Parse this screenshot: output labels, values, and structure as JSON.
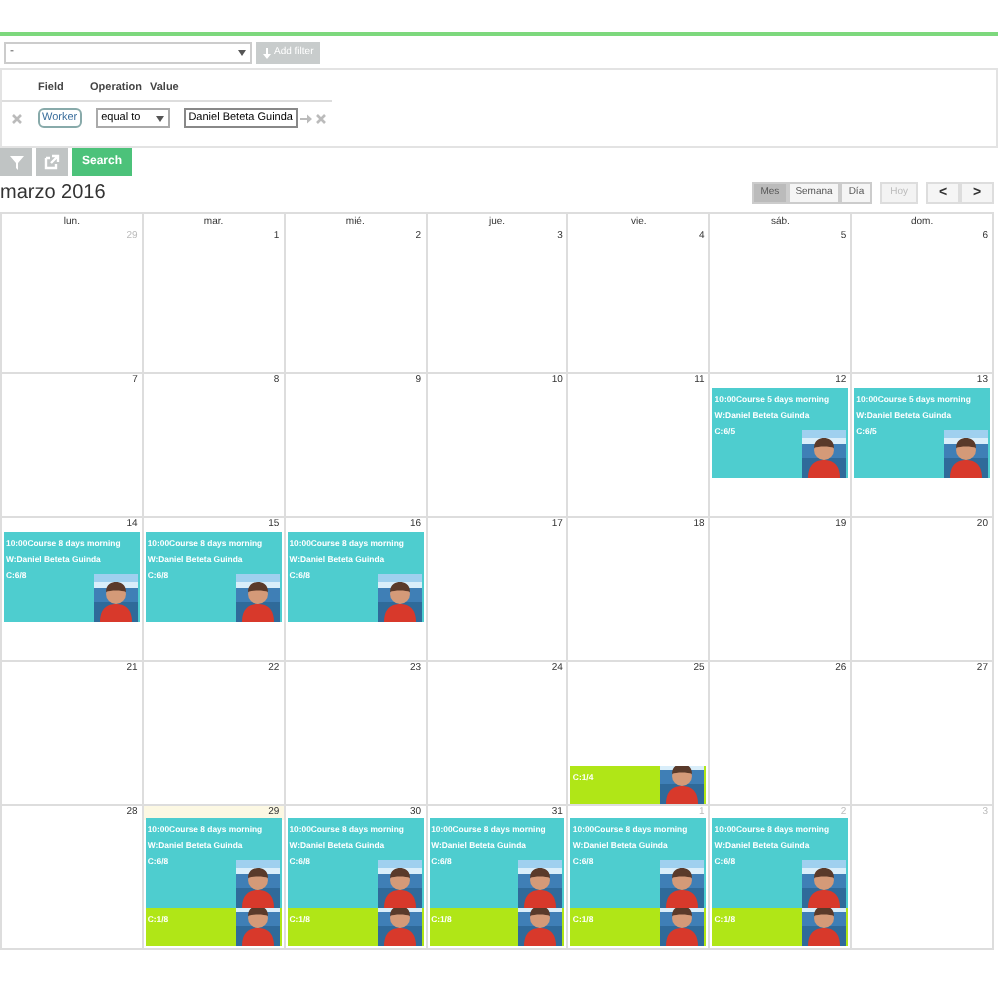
{
  "filter_bar": {
    "field_select": "-",
    "add_filter": {
      "label": "Add filter",
      "disabled": true
    }
  },
  "conditions": {
    "columns": [
      "Field",
      "Operation",
      "Value"
    ],
    "rows": [
      {
        "field": "Worker",
        "operation": "equal to",
        "value": "Daniel Beteta Guinda"
      }
    ]
  },
  "actions": [
    {
      "kind": "filter"
    },
    {
      "kind": "export"
    },
    {
      "kind": "text",
      "label": "Search"
    }
  ],
  "calendar": {
    "title": "marzo 2016",
    "views": [
      {
        "label": "Mes",
        "selected": true
      },
      {
        "label": "Semana",
        "selected": false
      },
      {
        "label": "Día",
        "selected": false
      }
    ],
    "today_button": {
      "label": "Hoy",
      "disabled": true
    },
    "nav": [
      "<",
      ">"
    ],
    "weekdays": [
      "lun.",
      "mar.",
      "mié.",
      "jue.",
      "vie.",
      "sáb.",
      "dom."
    ],
    "weeks": [
      {
        "days": [
          {
            "number": "29",
            "other_month": true,
            "today": false
          },
          {
            "number": "1",
            "other_month": false,
            "today": false
          },
          {
            "number": "2",
            "other_month": false,
            "today": false
          },
          {
            "number": "3",
            "other_month": false,
            "today": false
          },
          {
            "number": "4",
            "other_month": false,
            "today": false
          },
          {
            "number": "5",
            "other_month": false,
            "today": false
          },
          {
            "number": "6",
            "other_month": false,
            "today": false
          }
        ]
      },
      {
        "days": [
          {
            "number": "7",
            "other_month": false,
            "today": false
          },
          {
            "number": "8",
            "other_month": false,
            "today": false
          },
          {
            "number": "9",
            "other_month": false,
            "today": false
          },
          {
            "number": "10",
            "other_month": false,
            "today": false
          },
          {
            "number": "11",
            "other_month": false,
            "today": false
          },
          {
            "number": "12",
            "other_month": false,
            "today": false,
            "events": [
              {
                "color": "#4ecdcf",
                "lines": [
                  "10:00Course 5 days morning",
                  "W:Daniel Beteta Guinda",
                  "C:6/5"
                ]
              }
            ]
          },
          {
            "number": "13",
            "other_month": false,
            "today": false,
            "events": [
              {
                "color": "#4ecdcf",
                "lines": [
                  "10:00Course 5 days morning",
                  "W:Daniel Beteta Guinda",
                  "C:6/5"
                ]
              }
            ]
          }
        ]
      },
      {
        "days": [
          {
            "number": "14",
            "other_month": false,
            "today": false,
            "events": [
              {
                "color": "#4ecdcf",
                "lines": [
                  "10:00Course 8 days morning",
                  "W:Daniel Beteta Guinda",
                  "C:6/8"
                ]
              }
            ]
          },
          {
            "number": "15",
            "other_month": false,
            "today": false,
            "events": [
              {
                "color": "#4ecdcf",
                "lines": [
                  "10:00Course 8 days morning",
                  "W:Daniel Beteta Guinda",
                  "C:6/8"
                ]
              }
            ]
          },
          {
            "number": "16",
            "other_month": false,
            "today": false,
            "events": [
              {
                "color": "#4ecdcf",
                "lines": [
                  "10:00Course 8 days morning",
                  "W:Daniel Beteta Guinda",
                  "C:6/8"
                ]
              }
            ]
          },
          {
            "number": "17",
            "other_month": false,
            "today": false
          },
          {
            "number": "18",
            "other_month": false,
            "today": false
          },
          {
            "number": "19",
            "other_month": false,
            "today": false
          },
          {
            "number": "20",
            "other_month": false,
            "today": false
          }
        ]
      },
      {
        "days": [
          {
            "number": "21",
            "other_month": false,
            "today": false
          },
          {
            "number": "22",
            "other_month": false,
            "today": false
          },
          {
            "number": "23",
            "other_month": false,
            "today": false
          },
          {
            "number": "24",
            "other_month": false,
            "today": false
          },
          {
            "number": "25",
            "other_month": false,
            "today": false,
            "events": [
              {
                "color": "#b0e617",
                "lines": [
                  "C:1/4"
                ]
              }
            ]
          },
          {
            "number": "26",
            "other_month": false,
            "today": false
          },
          {
            "number": "27",
            "other_month": false,
            "today": false
          }
        ]
      },
      {
        "days": [
          {
            "number": "28",
            "other_month": false,
            "today": false
          },
          {
            "number": "29",
            "other_month": false,
            "today": true,
            "events": [
              {
                "color": "#4ecdcf",
                "lines": [
                  "10:00Course 8 days morning",
                  "W:Daniel Beteta Guinda",
                  "C:6/8"
                ]
              },
              {
                "color": "#b0e617",
                "lines": [
                  "C:1/8"
                ]
              }
            ]
          },
          {
            "number": "30",
            "other_month": false,
            "today": false,
            "events": [
              {
                "color": "#4ecdcf",
                "lines": [
                  "10:00Course 8 days morning",
                  "W:Daniel Beteta Guinda",
                  "C:6/8"
                ]
              },
              {
                "color": "#b0e617",
                "lines": [
                  "C:1/8"
                ]
              }
            ]
          },
          {
            "number": "31",
            "other_month": false,
            "today": false,
            "events": [
              {
                "color": "#4ecdcf",
                "lines": [
                  "10:00Course 8 days morning",
                  "W:Daniel Beteta Guinda",
                  "C:6/8"
                ]
              },
              {
                "color": "#b0e617",
                "lines": [
                  "C:1/8"
                ]
              }
            ]
          },
          {
            "number": "1",
            "other_month": true,
            "today": false,
            "events": [
              {
                "color": "#4ecdcf",
                "lines": [
                  "10:00Course 8 days morning",
                  "W:Daniel Beteta Guinda",
                  "C:6/8"
                ]
              },
              {
                "color": "#b0e617",
                "lines": [
                  "C:1/8"
                ]
              }
            ]
          },
          {
            "number": "2",
            "other_month": true,
            "today": false,
            "events": [
              {
                "color": "#4ecdcf",
                "lines": [
                  "10:00Course 8 days morning",
                  "W:Daniel Beteta Guinda",
                  "C:6/8"
                ]
              },
              {
                "color": "#b0e617",
                "lines": [
                  "C:1/8"
                ]
              }
            ]
          },
          {
            "number": "3",
            "other_month": true,
            "today": false
          }
        ]
      }
    ]
  }
}
